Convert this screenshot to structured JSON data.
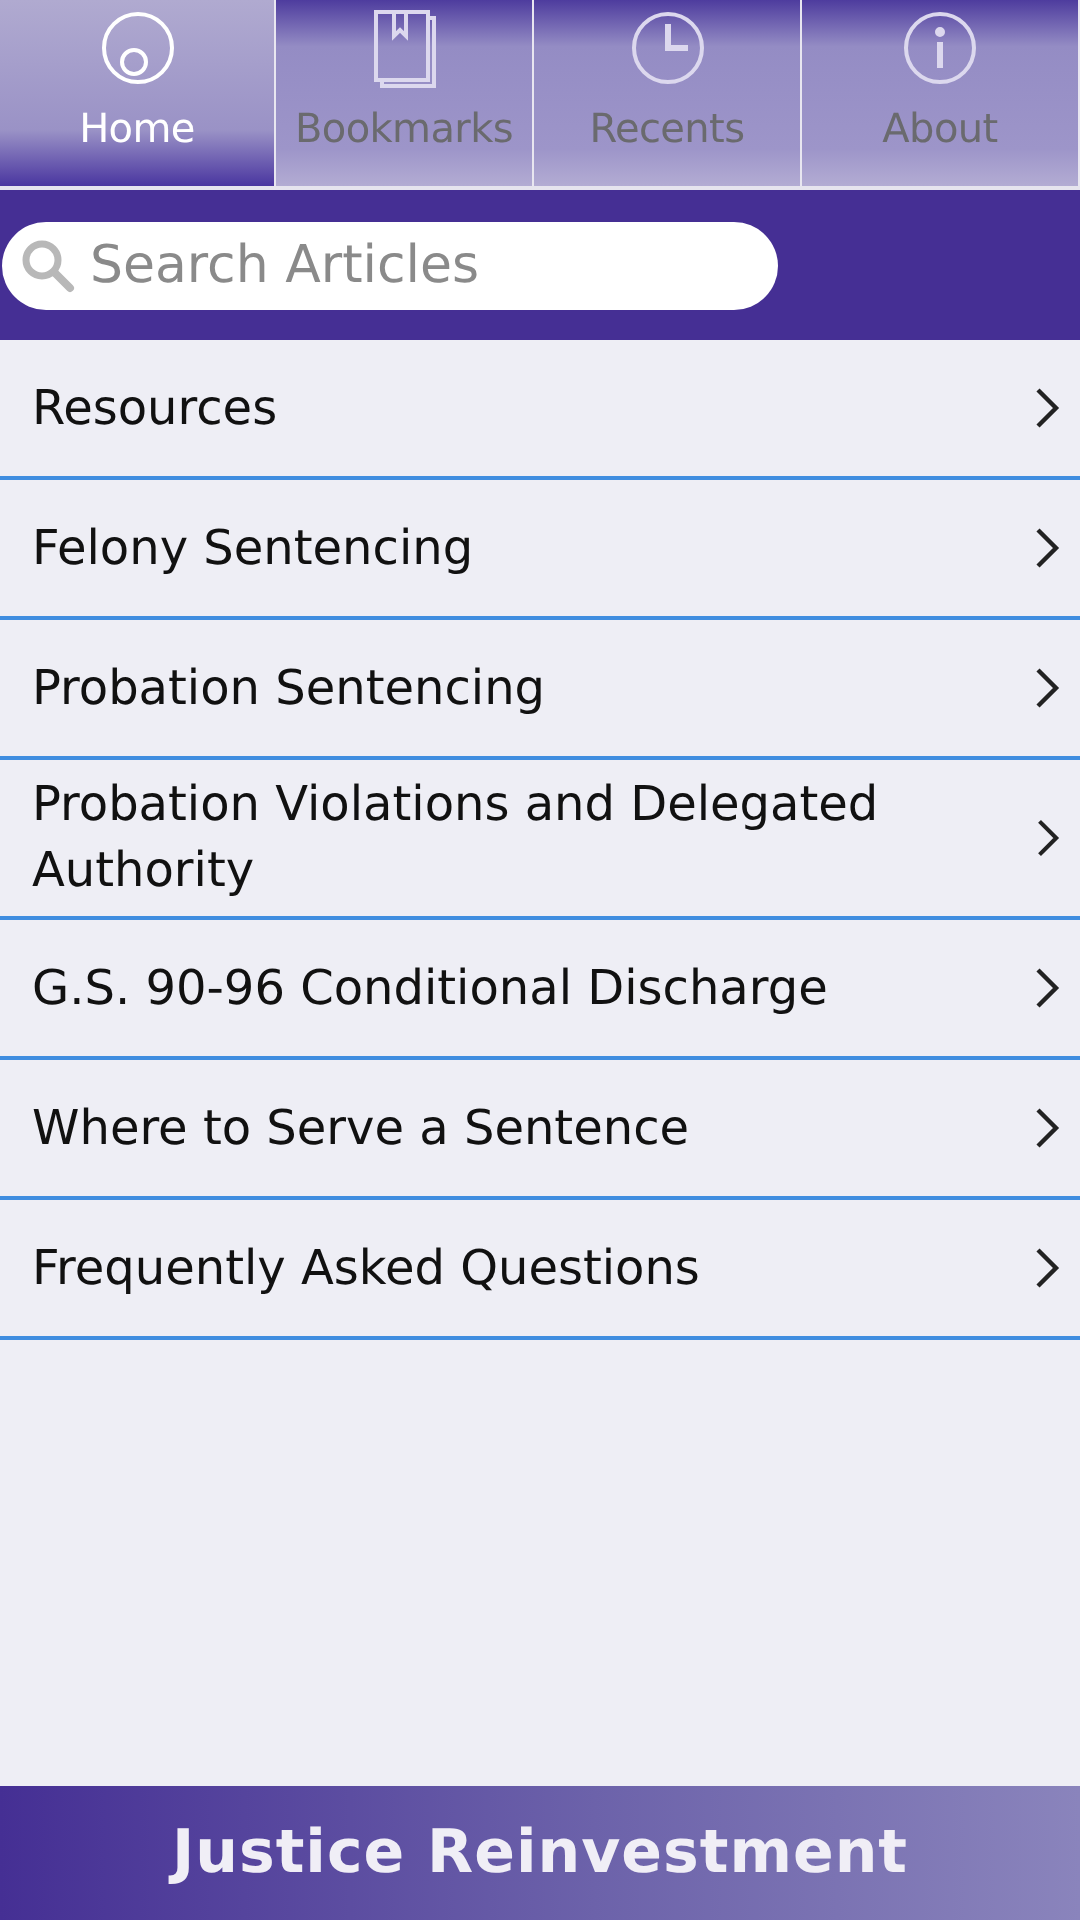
{
  "tabs": [
    {
      "label": "Home",
      "kind": "home",
      "selected": true
    },
    {
      "label": "Bookmarks",
      "kind": "bookmarks",
      "selected": false
    },
    {
      "label": "Recents",
      "kind": "recents",
      "selected": false
    },
    {
      "label": "About",
      "kind": "about",
      "selected": false
    }
  ],
  "search": {
    "placeholder": "Search Articles"
  },
  "articles": [
    {
      "title": "Resources"
    },
    {
      "title": "Felony Sentencing"
    },
    {
      "title": "Probation Sentencing"
    },
    {
      "title": "Probation Violations and Delegated Authority"
    },
    {
      "title": "G.S. 90-96 Conditional Discharge"
    },
    {
      "title": "Where to Serve a Sentence"
    },
    {
      "title": "Frequently Asked Questions"
    }
  ],
  "footer": {
    "title": "Justice Reinvestment"
  }
}
